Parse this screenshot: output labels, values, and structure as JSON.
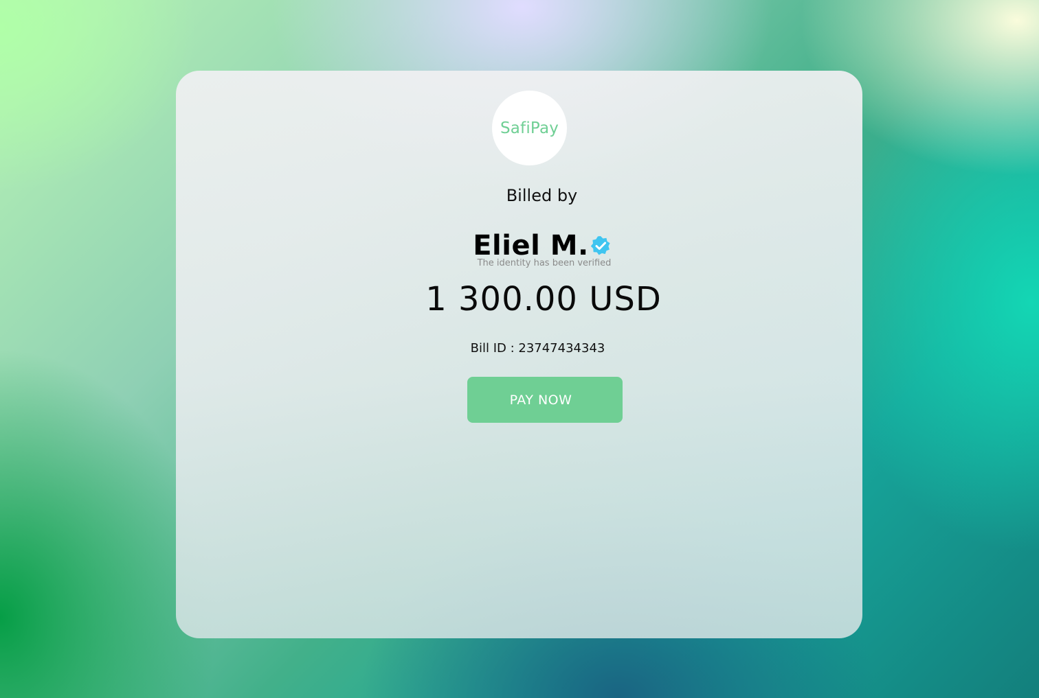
{
  "brand": {
    "logo_text": "SafiPay",
    "accent_color": "#6fcf94"
  },
  "bill": {
    "billed_by_label": "Billed by",
    "merchant_name": "Eliel M.",
    "verified_icon": "verified-badge-icon",
    "verified_color": "#3fc5f0",
    "verified_note": "The identity has been verified",
    "amount": "1 300.00 USD",
    "bill_id_label": "Bill ID : 23747434343"
  },
  "actions": {
    "pay_label": "PAY NOW"
  }
}
